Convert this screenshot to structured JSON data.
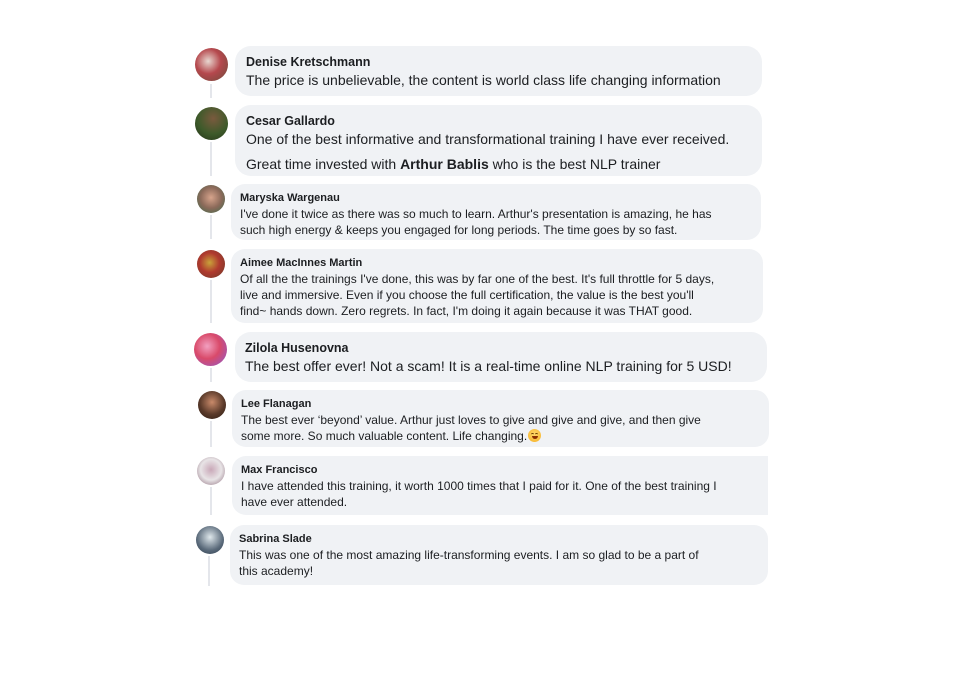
{
  "comments": [
    {
      "name": "Denise Kretschmann",
      "lines": [
        "The price is unbelievable, the content is world class life changing information"
      ],
      "avatar_colors": [
        "#b5484d",
        "#e8d7d0",
        "#6b4a3a"
      ]
    },
    {
      "name": "Cesar Gallardo",
      "lines": [
        "One of the best informative and transformational training I have ever received."
      ],
      "line2_prefix": "Great time invested with ",
      "line2_bold": "Arthur Bablis",
      "line2_suffix": " who is the best NLP trainer",
      "avatar_colors": [
        "#3d5a2a",
        "#7a5a3e",
        "#233018"
      ]
    },
    {
      "name": "Maryska Wargenau",
      "lines": [
        "I've done it twice as there was so much to learn. Arthur's presentation is amazing, he has",
        "such high energy & keeps you engaged for long periods. The time goes by so fast."
      ],
      "avatar_colors": [
        "#8c6a5a",
        "#d7a48c",
        "#3a6a4a"
      ]
    },
    {
      "name": "Aimee MacInnes Martin",
      "lines": [
        "Of all the the trainings I've done, this was by far one of the best. It's full throttle for 5 days,",
        "live and immersive. Even if you choose the full certification, the value is the best you'll",
        "find~ hands down. Zero regrets. In fact, I'm doing it again because it was THAT good."
      ],
      "avatar_colors": [
        "#6a3a2a",
        "#b03a2e",
        "#c9a23a"
      ]
    },
    {
      "name": "Zilola Husenovna",
      "lines": [
        "The best offer ever! Not a scam! It is a real-time online NLP training for 5 USD!"
      ],
      "avatar_colors": [
        "#d94a6a",
        "#f2a0c0",
        "#8a5ad0"
      ]
    },
    {
      "name": "Lee Flanagan",
      "lines": [
        "The best ever ‘beyond’ value. Arthur just loves to give and give and give, and then give",
        "some more. So much valuable content. Life changing."
      ],
      "has_emoji": true,
      "emoji_name": "grinning-face-emoji",
      "avatar_colors": [
        "#5a3a2a",
        "#c98a6a",
        "#2a1a12"
      ]
    },
    {
      "name": "Max Francisco",
      "lines": [
        "I have attended this training, it worth 1000 times that I paid for it. One of the best training I",
        "have ever attended."
      ],
      "avatar_colors": [
        "#e8e4e6",
        "#c9a8b8",
        "#8a6a7a"
      ]
    },
    {
      "name": "Sabrina Slade",
      "lines": [
        "This was one of the most amazing life-transforming events. I am so glad to be a part of",
        "this academy!"
      ],
      "avatar_colors": [
        "#dfe8ec",
        "#5a6a7a",
        "#2a3a4a"
      ]
    }
  ]
}
